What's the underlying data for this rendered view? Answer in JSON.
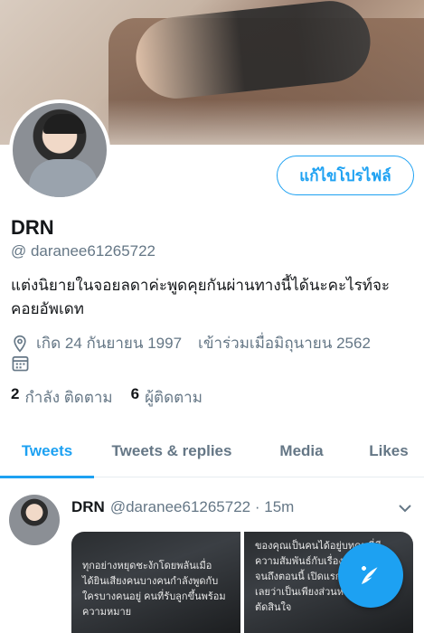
{
  "profile": {
    "edit_label": "แก้ไขโปรไฟล์",
    "name": "DRN",
    "handle": "@ daranee61265722",
    "bio": "แต่งนิยายในจอยลดาค่ะพูดคุยกันผ่านทางนี้ได้นะคะไรท์จะคอยอัพเดท",
    "birth": "เกิด 24 กันยายน 1997",
    "joined": "เข้าร่วมเมื่อมิถุนายน 2562",
    "following_count": "2",
    "following_label": "กำลัง ติดตาม",
    "followers_count": "6",
    "followers_label": "ผู้ติดตาม"
  },
  "tabs": [
    {
      "label": "Tweets",
      "active": true
    },
    {
      "label": "Tweets & replies",
      "active": false
    },
    {
      "label": "Media",
      "active": false
    },
    {
      "label": "Likes",
      "active": false
    }
  ],
  "tweet": {
    "name": "DRN",
    "handle_time": "@daranee61265722 · 15m",
    "image1_text": "ทุกอย่างหยุดชะงักโดยพลันเมื่อได้ยินเสียงคนบางคนกำลังพูดกับใครบางคนอยู่ คนที่รับลูกขึ้นพร้อมความหมาย",
    "image2_text": "ของคุณเป็นคนได้อยู่บทคนที่มีความสัมพันธ์กับเรื่องทั้งหมดที่มาจนถึงตอนนี้ เปิดแรกอย่างชัดเจนเลยว่าเป็นเพียงส่วนหนึ่งของการตัดสินใจ"
  },
  "colors": {
    "accent": "#1da1f2",
    "secondary_text": "#657786"
  },
  "icons": [
    "location-pin-icon",
    "calendar-icon",
    "chevron-down-icon",
    "compose-tweet-icon"
  ]
}
